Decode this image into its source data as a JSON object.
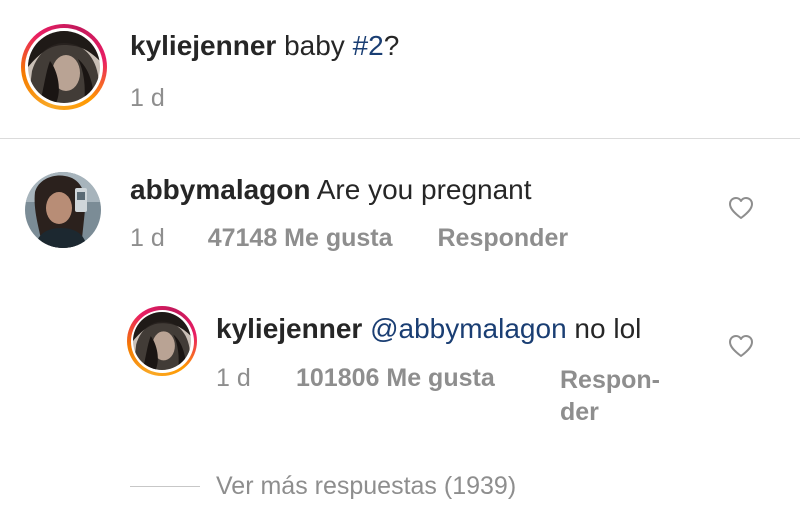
{
  "caption": {
    "username": "kyliejenner",
    "text_before": "baby ",
    "hashtag": "#2",
    "text_after": "?",
    "time": "1 d"
  },
  "comment": {
    "username": "abbymalagon",
    "text": "Are you pregnant",
    "time": "1 d",
    "likes": "47148 Me gusta",
    "reply_label": "Responder"
  },
  "reply": {
    "username": "kyliejenner",
    "mention": "@abbymalagon",
    "text": "no lol",
    "time": "1 d",
    "likes": "101806 Me gusta",
    "reply_label_line1": "Respon-",
    "reply_label_line2": "der"
  },
  "more_replies": "Ver más respuestas (1939)",
  "icons": [
    "heart-outline-icon"
  ],
  "colors": {
    "mention": "#1a3e73",
    "meta": "#8e8e8e",
    "divider": "#dbdbdb"
  }
}
